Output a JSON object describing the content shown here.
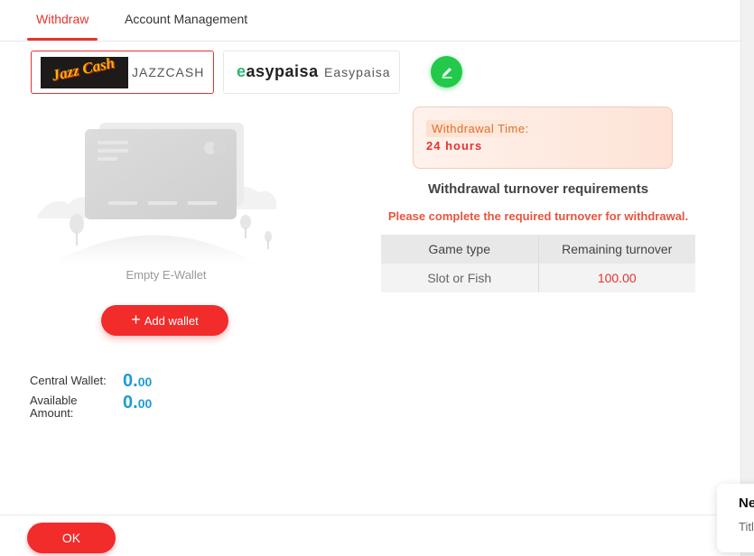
{
  "tabs": [
    {
      "label": "Withdraw",
      "active": true
    },
    {
      "label": "Account Management",
      "active": false
    }
  ],
  "channels": [
    {
      "name": "JAZZCASH",
      "logo_text": "Jazz Cash",
      "selected": true
    },
    {
      "name": "Easypaisa",
      "logo_text": "easypaisa",
      "selected": false
    }
  ],
  "edit_icon": "pencil-icon",
  "wallet": {
    "empty_text": "Empty E-Wallet",
    "add_label": "Add wallet",
    "central_label": "Central Wallet:",
    "central_int": "0.",
    "central_dec": "00",
    "available_label_1": "Available",
    "available_label_2": "Amount:",
    "available_int": "0.",
    "available_dec": "00"
  },
  "withdrawal": {
    "time_label": "Withdrawal Time:",
    "time_value": "24 hours",
    "turnover_title": "Withdrawal turnover requirements",
    "turnover_note": "Please complete the required turnover for withdrawal.",
    "table": {
      "headers": [
        "Game type",
        "Remaining turnover"
      ],
      "rows": [
        [
          "Slot or Fish",
          "100.00"
        ]
      ]
    }
  },
  "footer": {
    "ok_label": "OK"
  },
  "notification": {
    "title": "Ne",
    "subtitle": "Titl"
  },
  "colors": {
    "accent_red": "#f22b2b",
    "balance_blue": "#1e9bd6",
    "edit_green": "#22c94a",
    "time_orange": "#e26d2e"
  }
}
